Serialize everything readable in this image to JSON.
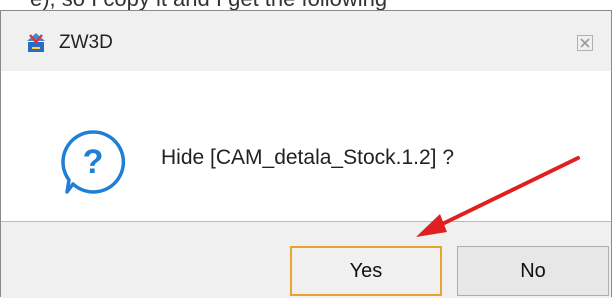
{
  "background_text": "e), so I copy it and I get the following",
  "dialog": {
    "title": "ZW3D",
    "message": "Hide [CAM_detala_Stock.1.2] ?",
    "buttons": {
      "yes_label": "Yes",
      "no_label": "No"
    }
  },
  "icons": {
    "app": "zw3d-logo-icon",
    "close": "close-icon",
    "question": "question-icon",
    "annotation": "red-arrow-annotation"
  },
  "colors": {
    "accent_blue": "#1e7fd6",
    "yes_border": "#e8a42f",
    "arrow_red": "#e02020"
  }
}
